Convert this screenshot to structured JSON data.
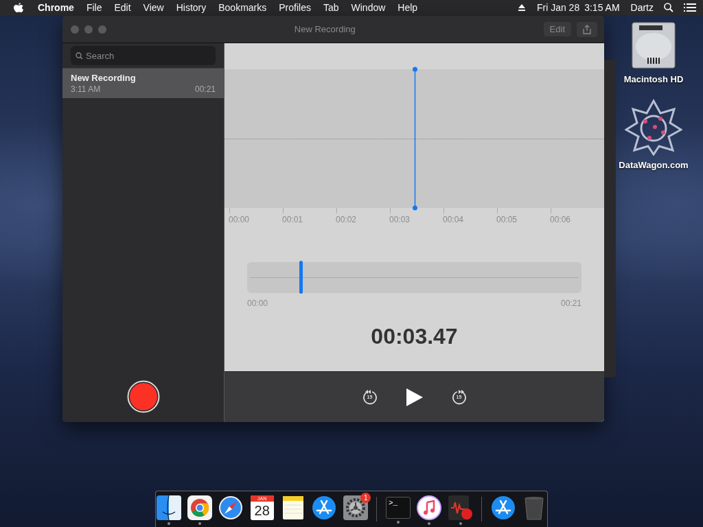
{
  "menu_bar": {
    "app": "Chrome",
    "menus": [
      "File",
      "Edit",
      "View",
      "History",
      "Bookmarks",
      "Profiles",
      "Tab",
      "Window",
      "Help"
    ],
    "date": "Fri Jan 28",
    "time": "3:15 AM",
    "user": "Dartz"
  },
  "window": {
    "title": "New Recording",
    "edit_button": "Edit",
    "sidebar": {
      "search": {
        "placeholder": "Search"
      },
      "recordings": [
        {
          "name": "New Recording",
          "time": "3:11 AM",
          "duration": "00:21",
          "selected": true
        }
      ]
    },
    "waveform": {
      "ticks": [
        "00:00",
        "00:01",
        "00:02",
        "00:03",
        "00:04",
        "00:05",
        "00:06"
      ],
      "playhead": {
        "level": 0.5
      }
    },
    "scrubber": {
      "level": 0.16,
      "start": "00:00",
      "end": "00:21"
    },
    "current_time": "00:03.47",
    "controls": {
      "skip_back": "15",
      "skip_forward": "15"
    }
  },
  "desktop_icons": [
    {
      "kind": "disk",
      "label": "Macintosh HD"
    },
    {
      "kind": "star",
      "label": "DataWagon.com"
    }
  ],
  "dock": [
    {
      "kind": "finder",
      "running": true
    },
    {
      "kind": "chrome",
      "running": true
    },
    {
      "kind": "safari",
      "running": false
    },
    {
      "kind": "calendar",
      "month": "JAN",
      "day": "28",
      "running": false
    },
    {
      "kind": "notes",
      "running": false
    },
    {
      "kind": "appstore",
      "running": false
    },
    {
      "kind": "settings",
      "badge": "1",
      "running": false
    },
    {
      "kind": "separator"
    },
    {
      "kind": "terminal",
      "prompt": ">_",
      "running": true
    },
    {
      "kind": "music",
      "running": true
    },
    {
      "kind": "voice",
      "running": true
    },
    {
      "kind": "separator"
    },
    {
      "kind": "appstore",
      "running": false
    },
    {
      "kind": "trash",
      "running": false
    }
  ]
}
